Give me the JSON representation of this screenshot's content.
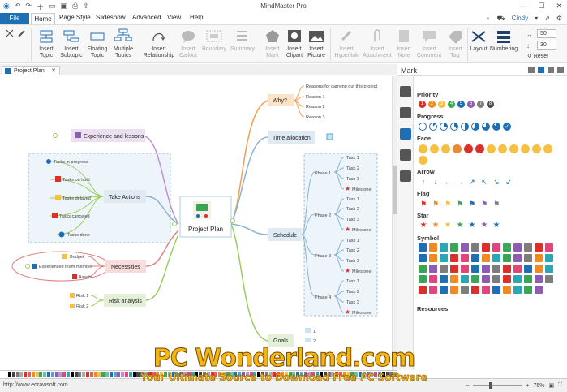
{
  "app": {
    "title": "MindMaster Pro"
  },
  "menu": {
    "file": "File",
    "home": "Home",
    "page_style": "Page Style",
    "slideshow": "Slideshow",
    "advanced": "Advanced",
    "view": "View",
    "help": "Help"
  },
  "user": {
    "name": "Cindy"
  },
  "ribbon": {
    "insert_topic": "Insert\nTopic",
    "insert_subtopic": "Insert\nSubtopic",
    "floating_topic": "Floating\nTopic",
    "multiple_topics": "Multiple\nTopics",
    "insert_relationship": "Insert\nRelationship",
    "insert_callout": "Insert\nCallout",
    "boundary": "Boundary",
    "summary": "Summary",
    "insert_mark": "Insert\nMark",
    "insert_clipart": "Insert\nClipart",
    "insert_picture": "Insert\nPicture",
    "insert_hyperlink": "Insert\nHyperlink",
    "insert_attachment": "Insert\nAttachment",
    "insert_note": "Insert\nNote",
    "insert_comment": "Insert\nComment",
    "insert_tag": "Insert\nTag",
    "layout": "Layout",
    "numbering": "Numbering",
    "spacing_h": "50",
    "spacing_v": "30",
    "reset": "Reset"
  },
  "doc_tab": {
    "label": "Project Plan"
  },
  "mindmap": {
    "central": "Project Plan",
    "why": "Why?",
    "why_items": [
      "Reasons for carrying out this project",
      "Reason 1",
      "Reason 2",
      "Reason 3"
    ],
    "time_allocation": "Time allocation",
    "schedule": "Schedule",
    "phases": [
      "Phase 1",
      "Phase 2",
      "Phase 3",
      "Phase 4"
    ],
    "tasks": [
      "Task 1",
      "Task 2",
      "Task 3"
    ],
    "milestone": "Milestone",
    "goals": "Goals",
    "goals_items": [
      "1",
      "2"
    ],
    "experience": "Experience and lessons",
    "take_actions": "Take Actions",
    "actions": [
      "Tasks in progress",
      "Tasks on hold",
      "Tasks delayed",
      "Tasks canceled",
      "Tasks done"
    ],
    "necessities": "Necessities",
    "necessity_items": [
      "Budget",
      "Experienced team member",
      "Assets"
    ],
    "risk_analysis": "Risk analysis",
    "risks": [
      "Risk 1",
      "Risk 2"
    ]
  },
  "panel": {
    "title": "Mark",
    "priority": "Priority",
    "progress": "Progress",
    "face": "Face",
    "arrow": "Arrow",
    "flag": "Flag",
    "star": "Star",
    "symbol": "Symbol",
    "resources": "Resources",
    "priority_values": [
      "1",
      "2",
      "3",
      "4",
      "5",
      "6",
      "7",
      "8"
    ],
    "priority_colors": [
      "#d9302c",
      "#f08a24",
      "#f5c142",
      "#3aa655",
      "#1f6fb5",
      "#8e5bb5",
      "#7d7d7d",
      "#4a4a4a"
    ],
    "arrow_glyphs": [
      "↑",
      "↓",
      "←",
      "→",
      "↗",
      "↖",
      "↘",
      "↙"
    ],
    "flag_colors": [
      "#d9302c",
      "#f08a24",
      "#f5c142",
      "#3aa655",
      "#1f6fb5",
      "#8e5bb5",
      "#7d7d7d"
    ],
    "star_colors": [
      "#d9302c",
      "#f08a24",
      "#f5c142",
      "#3aa655",
      "#1f6fb5",
      "#8e5bb5",
      "#1f6fb5"
    ]
  },
  "status": {
    "link": "http://www.edrawsoft.com",
    "zoom": "75%"
  },
  "watermark": {
    "logo": "PC Wonderland.com",
    "tagline": "Your Ultimate Source to Download Free PC Software"
  }
}
